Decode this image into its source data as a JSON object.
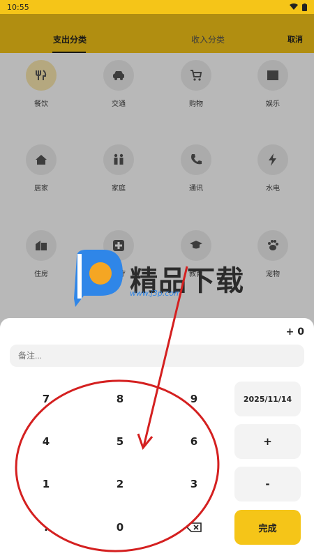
{
  "status": {
    "time": "10:55"
  },
  "header": {
    "tab_expense": "支出分类",
    "tab_income": "收入分类",
    "cancel": "取消"
  },
  "categories": [
    {
      "label": "餐饮",
      "icon": "utensils-icon",
      "selected": true
    },
    {
      "label": "交通",
      "icon": "car-icon"
    },
    {
      "label": "购物",
      "icon": "cart-icon"
    },
    {
      "label": "娱乐",
      "icon": "clapperboard-icon"
    },
    {
      "label": "居家",
      "icon": "home-icon"
    },
    {
      "label": "家庭",
      "icon": "family-icon"
    },
    {
      "label": "通讯",
      "icon": "phone-icon"
    },
    {
      "label": "水电",
      "icon": "bolt-icon"
    },
    {
      "label": "住房",
      "icon": "building-icon"
    },
    {
      "label": "医疗",
      "icon": "medical-icon"
    },
    {
      "label": "教育",
      "icon": "graduation-icon"
    },
    {
      "label": "宠物",
      "icon": "paw-icon"
    }
  ],
  "sheet": {
    "amount": "+ 0",
    "note_placeholder": "备注...",
    "date": "2025/11/14",
    "plus": "+",
    "minus": "-",
    "done": "完成",
    "keys": [
      "7",
      "8",
      "9",
      "4",
      "5",
      "6",
      "1",
      "2",
      "3",
      ".",
      "0"
    ]
  },
  "watermark": {
    "text": "精品下载",
    "url": "www.j3p.com"
  },
  "colors": {
    "accent": "#f5c518"
  }
}
